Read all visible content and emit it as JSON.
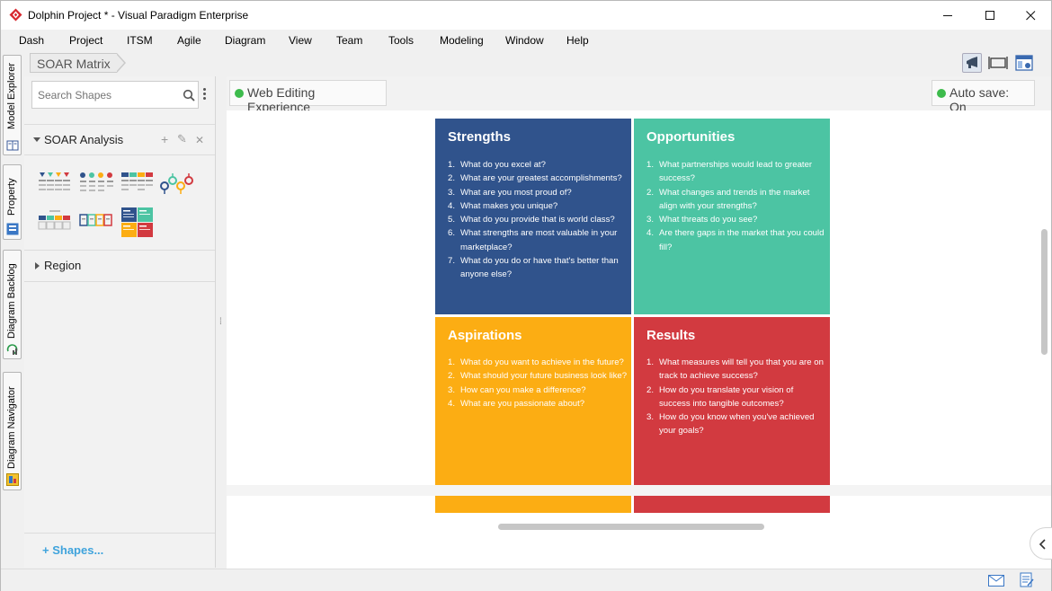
{
  "window": {
    "title": "Dolphin Project * - Visual Paradigm Enterprise",
    "minimize": "—",
    "maximize": "☐",
    "close": "✕"
  },
  "menu": [
    "Dash",
    "Project",
    "ITSM",
    "Agile",
    "Diagram",
    "View",
    "Team",
    "Tools",
    "Modeling",
    "Window",
    "Help"
  ],
  "vtabs": [
    "Model Explorer",
    "Property",
    "Diagram Backlog",
    "Diagram Navigator"
  ],
  "breadcrumb": {
    "label": "SOAR Matrix"
  },
  "search": {
    "placeholder": "Search Shapes",
    "value": ""
  },
  "panel": {
    "group_title": "SOAR Analysis",
    "group_add": "+",
    "group_edit": "✎",
    "group_close": "✕",
    "region_title": "Region",
    "shapes_link": "+ Shapes..."
  },
  "infobar": {
    "left_tag": "Web Editing Experience",
    "right_tag": "Auto save: On",
    "status_color": "#3dbb4c"
  },
  "soar": {
    "strengths": {
      "title": "Strengths",
      "color": "#30538c",
      "items": [
        "What do you excel at?",
        "What are your greatest accomplishments?",
        "What are you most proud of?",
        "What makes you unique?",
        "What do you provide that is world class?",
        "What strengths are most valuable in your marketplace?",
        "What do you do or have that's better than anyone else?"
      ]
    },
    "opportunities": {
      "title": "Opportunities",
      "color": "#4cc4a3",
      "items": [
        "What partnerships would lead to greater success?",
        "What changes and trends in the market align with your strengths?",
        "What threats do you see?",
        "Are there gaps in the market that you could fill?"
      ]
    },
    "aspirations": {
      "title": "Aspirations",
      "color": "#fcad13",
      "items": [
        "What do you want to achieve in the future?",
        "What should your future business look like?",
        "How can you make a difference?",
        "What are you passionate about?"
      ]
    },
    "results": {
      "title": "Results",
      "color": "#d23a40",
      "items": [
        "What measures will tell you that you are on track to achieve success?",
        "How do you translate your vision of success into tangible outcomes?",
        "How do you know when you've achieved your goals?"
      ]
    }
  },
  "icons": {
    "app": "vp-logo-icon",
    "search": "search-icon",
    "kebab": "more-vertical-icon",
    "toolbar": [
      "megaphone-icon",
      "fit-width-icon",
      "panel-layout-icon"
    ],
    "status": [
      "mail-icon",
      "note-icon"
    ],
    "collapse": "chevron-left-icon"
  }
}
